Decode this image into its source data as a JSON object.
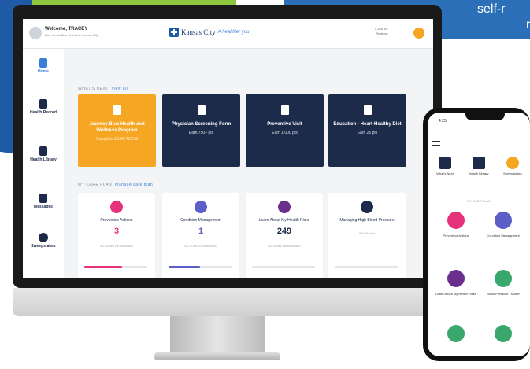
{
  "corner": {
    "line1": "self-r",
    "line2": "r"
  },
  "header": {
    "welcome": "Welcome, TRACEY",
    "subtitle": "Blue Cross Blue Shield of Kansas City",
    "brand": "Kansas City",
    "brand_tag": "A healthier you",
    "points_line1": "4,165 pts",
    "points_line2": "Redeem"
  },
  "sidebar": {
    "items": [
      {
        "label": "Home",
        "icon": "home-icon"
      },
      {
        "label": "Health Record",
        "icon": "clipboard-icon"
      },
      {
        "label": "Health Library",
        "icon": "book-icon"
      },
      {
        "label": "Messages",
        "icon": "envelope-icon"
      },
      {
        "label": "Sweepstakes",
        "icon": "star-icon"
      }
    ]
  },
  "whats_next": {
    "label": "WHAT'S NEXT",
    "link": "view all",
    "cards": [
      {
        "title": "Journey Blue Health and Wellness Program",
        "sub": "Complete 1/5 ACTIONS",
        "style": "gold"
      },
      {
        "title": "Physician Screening Form",
        "sub": "Earn 750+ pts",
        "style": "navy"
      },
      {
        "title": "Preventive Visit",
        "sub": "Earn 1,000 pts",
        "style": "navy"
      },
      {
        "title": "Education - Heart-Healthy Diet",
        "sub": "Earn 25 pts",
        "style": "navy"
      }
    ]
  },
  "care_plan": {
    "label": "MY CARE PLAN",
    "link": "Manage care plan",
    "cards": [
      {
        "title": "Preventive Actions",
        "number": "3",
        "sub": "ACTIONS REMAINING",
        "progress": 0.6,
        "icon_color": "#e6317d",
        "num_color": "#e6317d",
        "bar_color": "#e6317d"
      },
      {
        "title": "Condition Management",
        "number": "1",
        "sub": "ACTIONS REMAINING",
        "progress": 0.5,
        "icon_color": "#5b5fc7",
        "num_color": "#5b5fc7",
        "bar_color": "#5b5fc7"
      },
      {
        "title": "Learn About My Health Risks",
        "number": "249",
        "sub": "ACTIONS REMAINING",
        "progress": 0,
        "icon_color": "#6a2f8c",
        "num_color": "#1c2b4a",
        "bar_color": "#6a2f8c"
      },
      {
        "title": "Managing High Blood Pressure",
        "number": "",
        "sub": "Get Started",
        "progress": 0,
        "icon_color": "#1c2b4a",
        "num_color": "#1c2b4a",
        "bar_color": "#1c2b4a"
      }
    ]
  },
  "phone": {
    "time": "4:25",
    "nav": [
      {
        "label": "What's Next",
        "icon": "rocket-icon"
      },
      {
        "label": "Health Library",
        "icon": "book-icon"
      },
      {
        "label": "Sweepstakes",
        "icon": "star-icon"
      }
    ],
    "section": "MY CARE PLAN",
    "cards": [
      {
        "title": "Preventive Actions",
        "sub": "",
        "icon_color": "#e6317d"
      },
      {
        "title": "Condition Management",
        "sub": "",
        "icon_color": "#5b5fc7"
      },
      {
        "title": "Learn About My Health Risks",
        "sub": "",
        "icon_color": "#6a2f8c"
      },
      {
        "title": "Blood Pressure Tracker",
        "sub": "",
        "icon_color": "#3aa76d"
      }
    ]
  }
}
